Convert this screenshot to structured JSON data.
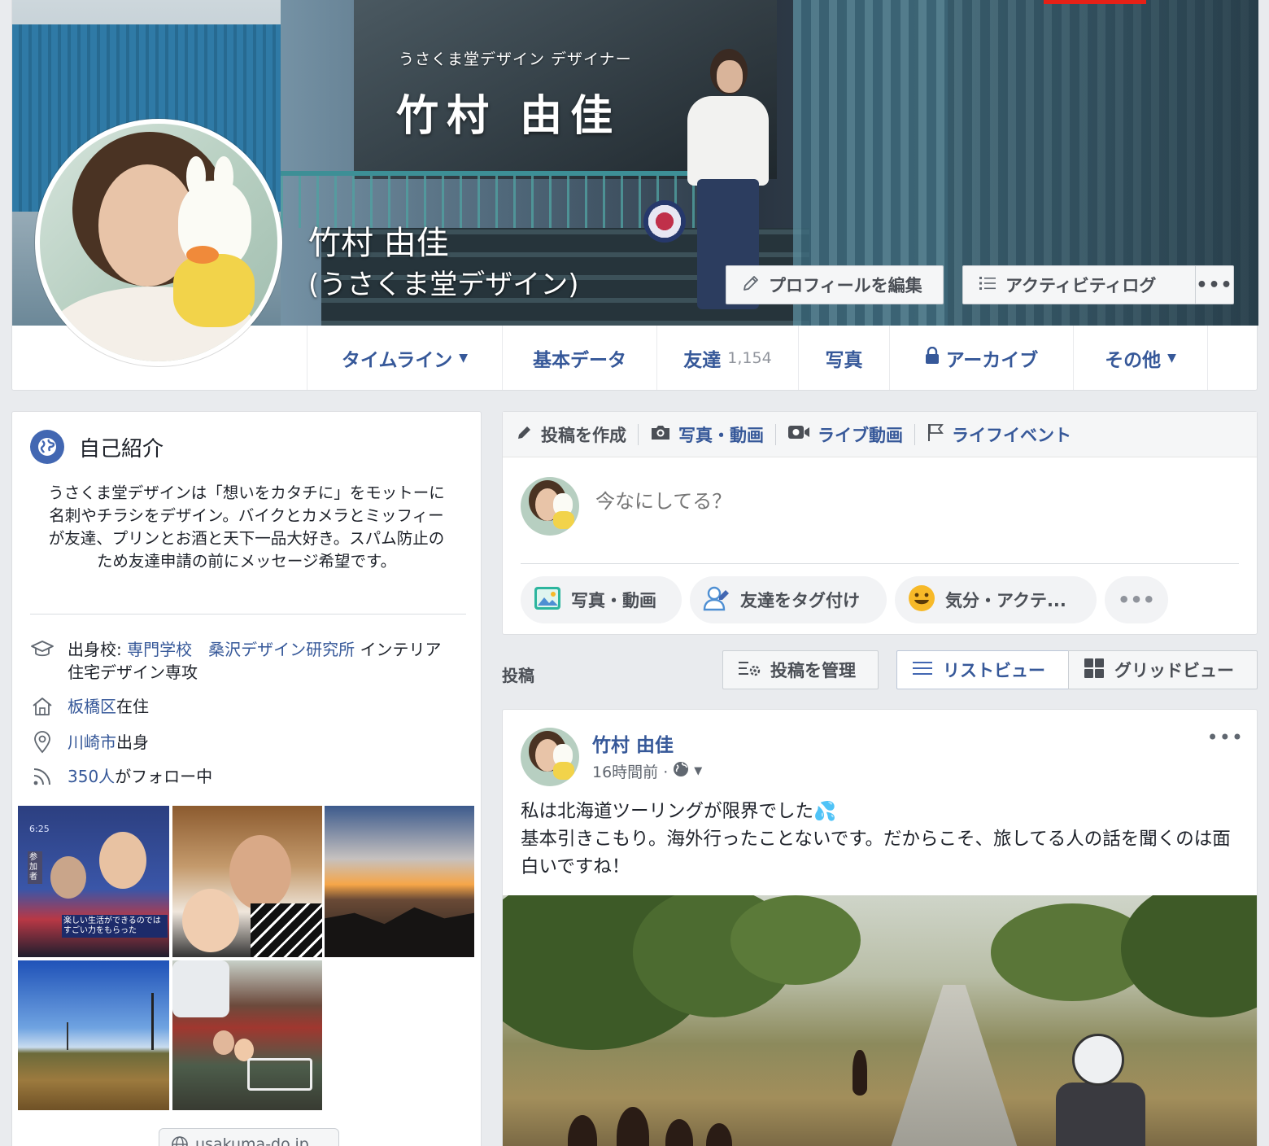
{
  "cover": {
    "subtitle": "うさくま堂デザイン デザイナー",
    "title": "竹村 由佳"
  },
  "profile": {
    "name": "竹村 由佳",
    "subname": "(うさくま堂デザイン)",
    "edit_button": "プロフィールを編集",
    "activity_log_button": "アクティビティログ",
    "more_button": "•••"
  },
  "tabs": {
    "timeline": "タイムライン",
    "about": "基本データ",
    "friends": "友達",
    "friends_count": "1,154",
    "photos": "写真",
    "archive": "アーカイブ",
    "more": "その他"
  },
  "intro": {
    "title": "自己紹介",
    "bio": "うさくま堂デザインは「想いをカタチに」をモットーに名刺やチラシをデザイン。バイクとカメラとミッフィーが友達、プリンとお酒と天下一品大好き。スパム防止のため友達申請の前にメッセージ希望です。",
    "education_prefix": "出身校: ",
    "education_link1": "専門学校",
    "education_link2": "桑沢デザイン研究所",
    "education_suffix": " インテリア住宅デザイン専攻",
    "lives_link": "板橋区",
    "lives_suffix": "在住",
    "from_link": "川崎市",
    "from_suffix": "出身",
    "followers_link": "350人",
    "followers_suffix": "がフォロー中",
    "thumb1_caption": "楽しい生活ができるのでは すごい力をもらった",
    "thumb1_time": "6:25",
    "thumb1_tag": "参加者",
    "website": "usakuma-do.jp"
  },
  "composer": {
    "tab_create": "投稿を作成",
    "tab_photo": "写真・動画",
    "tab_live": "ライブ動画",
    "tab_life_event": "ライフイベント",
    "placeholder": "今なにしてる？",
    "action_photo": "写真・動画",
    "action_tag": "友達をタグ付け",
    "action_feeling": "気分・アクテ...",
    "action_more": "•••"
  },
  "posts_toolbar": {
    "label": "投稿",
    "manage": "投稿を管理",
    "list_view": "リストビュー",
    "grid_view": "グリッドビュー"
  },
  "post": {
    "author": "竹村 由佳",
    "time": "16時間前 ·",
    "options": "•••",
    "line1": "私は北海道ツーリングが限界でした💦",
    "line2": "基本引きこもり。海外行ったことないです。だからこそ、旅してる人の話を聞くのは面白いですね！"
  },
  "colors": {
    "link": "#365899",
    "accent": "#4267b2",
    "background": "#e9ebee",
    "badge_red": "#e62117"
  }
}
